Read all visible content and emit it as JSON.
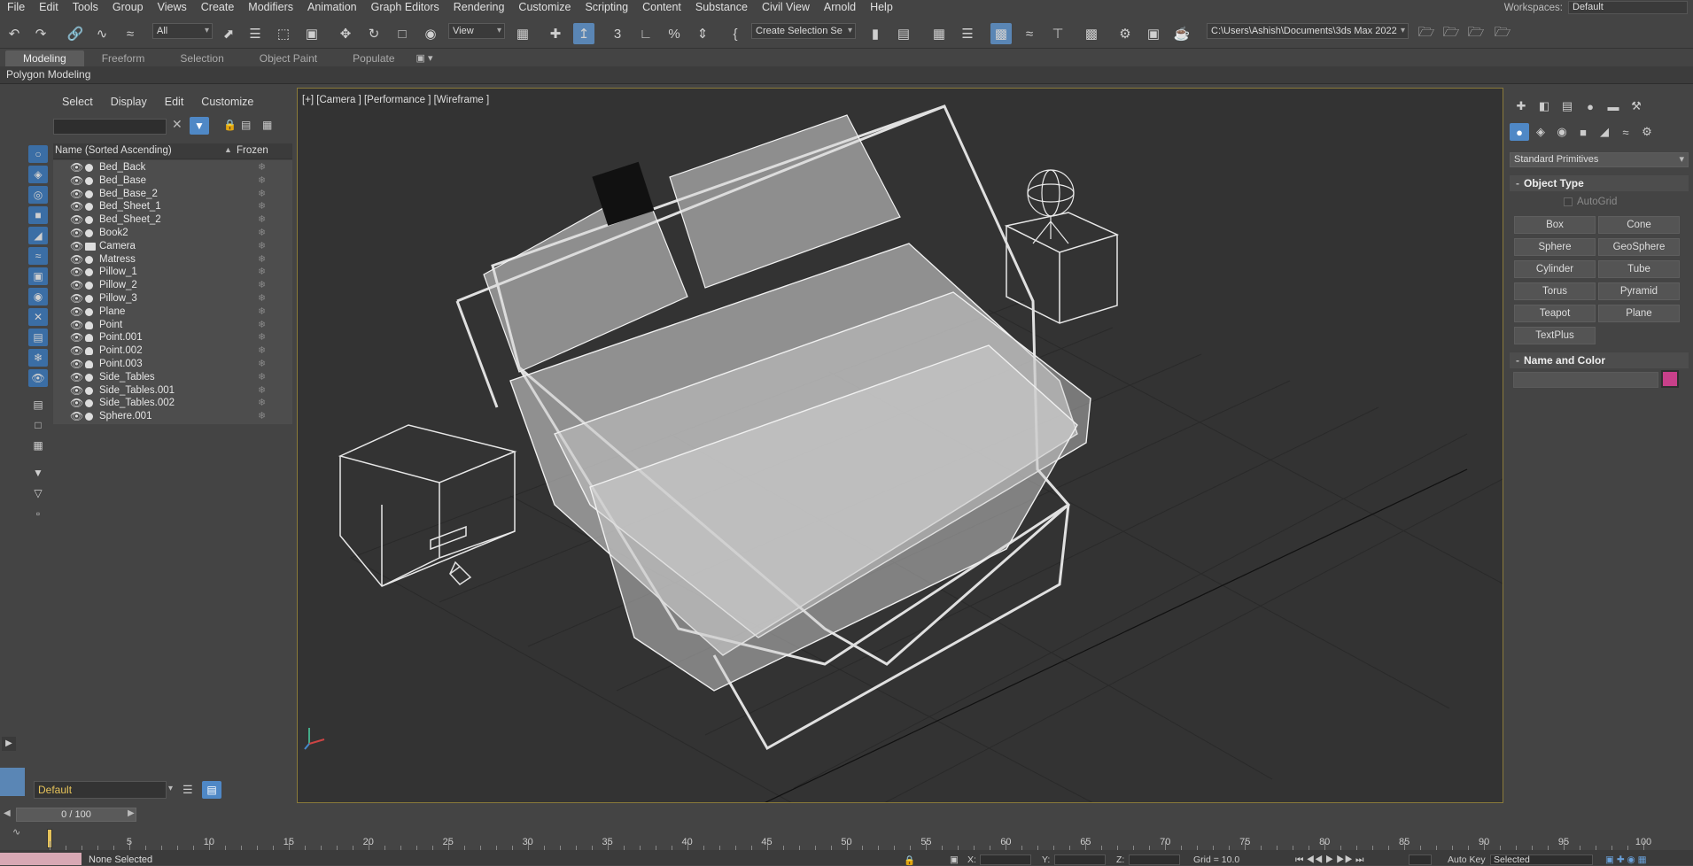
{
  "menu": [
    "File",
    "Edit",
    "Tools",
    "Group",
    "Views",
    "Create",
    "Modifiers",
    "Animation",
    "Graph Editors",
    "Rendering",
    "Customize",
    "Scripting",
    "Content",
    "Substance",
    "Civil View",
    "Arnold",
    "Help"
  ],
  "workspaces": {
    "label": "Workspaces:",
    "value": "Default"
  },
  "toolbar": {
    "selection_filter": "All",
    "ref_coord": "View",
    "create_selection_set": "Create Selection Se",
    "project_path": "C:\\Users\\Ashish\\Documents\\3ds Max 2022"
  },
  "ribbon": {
    "tabs": [
      "Modeling",
      "Freeform",
      "Selection",
      "Object Paint",
      "Populate"
    ],
    "active_tab": "Modeling",
    "panel_label": "Polygon Modeling"
  },
  "explorer": {
    "menu": [
      "Select",
      "Display",
      "Edit",
      "Customize"
    ],
    "header_name": "Name (Sorted Ascending)",
    "header_frozen": "Frozen",
    "items": [
      {
        "name": "Bed_Back",
        "icon": "geometry"
      },
      {
        "name": "Bed_Base",
        "icon": "geometry"
      },
      {
        "name": "Bed_Base_2",
        "icon": "geometry"
      },
      {
        "name": "Bed_Sheet_1",
        "icon": "geometry"
      },
      {
        "name": "Bed_Sheet_2",
        "icon": "geometry"
      },
      {
        "name": "Book2",
        "icon": "geometry"
      },
      {
        "name": "Camera",
        "icon": "camera"
      },
      {
        "name": "Matress",
        "icon": "geometry"
      },
      {
        "name": "Pillow_1",
        "icon": "geometry"
      },
      {
        "name": "Pillow_2",
        "icon": "geometry"
      },
      {
        "name": "Pillow_3",
        "icon": "geometry"
      },
      {
        "name": "Plane",
        "icon": "geometry"
      },
      {
        "name": "Point",
        "icon": "light"
      },
      {
        "name": "Point.001",
        "icon": "light"
      },
      {
        "name": "Point.002",
        "icon": "light"
      },
      {
        "name": "Point.003",
        "icon": "light"
      },
      {
        "name": "Side_Tables",
        "icon": "geometry"
      },
      {
        "name": "Side_Tables.001",
        "icon": "geometry"
      },
      {
        "name": "Side_Tables.002",
        "icon": "geometry"
      },
      {
        "name": "Sphere.001",
        "icon": "geometry"
      }
    ],
    "layer": "Default"
  },
  "viewport": {
    "label": "[+] [Camera ] [Performance ] [Wireframe ]"
  },
  "command_panel": {
    "category": "Standard Primitives",
    "object_type_title": "Object Type",
    "autogrid": "AutoGrid",
    "buttons": [
      "Box",
      "Cone",
      "Sphere",
      "GeoSphere",
      "Cylinder",
      "Tube",
      "Torus",
      "Pyramid",
      "Teapot",
      "Plane",
      "TextPlus"
    ],
    "name_color_title": "Name and Color",
    "object_color": "#c8408a"
  },
  "timeline": {
    "slider": "0 / 100",
    "ticks": [
      "0",
      "5",
      "10",
      "15",
      "20",
      "25",
      "30",
      "35",
      "40",
      "45",
      "50",
      "55",
      "60",
      "65",
      "70",
      "75",
      "80",
      "85",
      "90",
      "95",
      "100"
    ]
  },
  "status": {
    "text": "None Selected",
    "x_label": "X:",
    "y_label": "Y:",
    "z_label": "Z:",
    "grid": "Grid = 10.0",
    "auto_key": "Auto Key",
    "key_filter": "Selected"
  }
}
